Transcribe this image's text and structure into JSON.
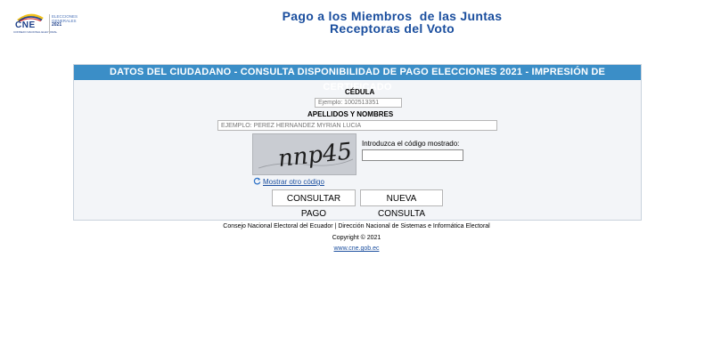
{
  "header": {
    "logo_text": "CNE",
    "logo_subtext": "CONSEJO NACIONAL ELECTORAL",
    "logo_elecciones": "ELECCIONES GENERALES",
    "logo_year": "2021",
    "title_line1": "Pago a los Miembros  de las Juntas",
    "title_line2": "Receptoras del Voto"
  },
  "panel": {
    "header": "DATOS DEL CIUDADANO - CONSULTA DISPONIBILIDAD DE PAGO ELECCIONES 2021 - IMPRESIÓN DE CERTIFICADO",
    "cedula_label": "CÉDULA",
    "cedula_placeholder": "Ejemplo: 1002513351",
    "nombres_label": "APELLIDOS Y NOMBRES",
    "nombres_placeholder": "EJEMPLO: PEREZ HERNANDEZ MYRIAN LUCIA",
    "captcha_text": "nnp45",
    "captcha_prompt": "Introduzca el código mostrado:",
    "captcha_value": "",
    "refresh_label": "Mostrar otro código",
    "consultar_label": "CONSULTAR PAGO",
    "nueva_label": "NUEVA CONSULTA"
  },
  "footer": {
    "line1": "Consejo Nacional Electoral del Ecuador | Dirección Nacional de Sistemas e Informática Electoral",
    "line2": "Copyright © 2021",
    "link": "www.cne.gob.ec"
  },
  "colors": {
    "accent": "#3b8ec7",
    "title": "#1a4e9e",
    "panel_bg": "#f3f5f8"
  }
}
